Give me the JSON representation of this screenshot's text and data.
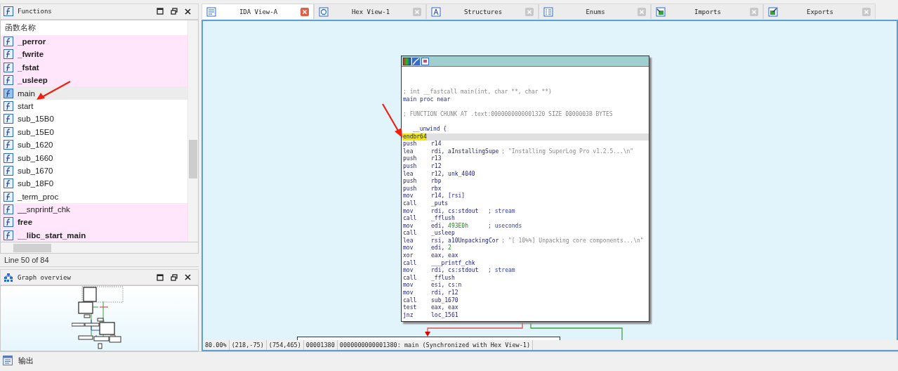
{
  "functions_panel": {
    "title": "Functions",
    "column": "函数名称",
    "items": [
      {
        "name": "_perror",
        "library": true,
        "bold": true,
        "selected": false
      },
      {
        "name": "_fwrite",
        "library": true,
        "bold": true,
        "selected": false
      },
      {
        "name": "_fstat",
        "library": true,
        "bold": true,
        "selected": false
      },
      {
        "name": "_usleep",
        "library": true,
        "bold": true,
        "selected": false
      },
      {
        "name": "main",
        "library": false,
        "bold": false,
        "selected": true
      },
      {
        "name": "start",
        "library": false,
        "bold": false,
        "selected": false
      },
      {
        "name": "sub_15B0",
        "library": false,
        "bold": false,
        "selected": false
      },
      {
        "name": "sub_15E0",
        "library": false,
        "bold": false,
        "selected": false
      },
      {
        "name": "sub_1620",
        "library": false,
        "bold": false,
        "selected": false
      },
      {
        "name": "sub_1660",
        "library": false,
        "bold": false,
        "selected": false
      },
      {
        "name": "sub_1670",
        "library": false,
        "bold": false,
        "selected": false
      },
      {
        "name": "sub_18F0",
        "library": false,
        "bold": false,
        "selected": false
      },
      {
        "name": "_term_proc",
        "library": false,
        "bold": false,
        "selected": false
      },
      {
        "name": "__snprintf_chk",
        "library": true,
        "bold": false,
        "selected": false
      },
      {
        "name": "free",
        "library": true,
        "bold": true,
        "selected": false
      },
      {
        "name": "__libc_start_main",
        "library": true,
        "bold": true,
        "selected": false
      }
    ],
    "status": "Line 50 of 84"
  },
  "overview_panel": {
    "title": "Graph overview"
  },
  "output_bar": {
    "title": "输出"
  },
  "tabs": [
    {
      "label": "IDA View-A",
      "kind": "view",
      "selected": true
    },
    {
      "label": "Hex View-1",
      "kind": "hex",
      "selected": false
    },
    {
      "label": "Structures",
      "kind": "struct",
      "selected": false
    },
    {
      "label": "Enums",
      "kind": "enum",
      "selected": false
    },
    {
      "label": "Imports",
      "kind": "import",
      "selected": false
    },
    {
      "label": "Exports",
      "kind": "export",
      "selected": false
    }
  ],
  "code": [
    {
      "kind": "comment",
      "text": "; int __fastcall main(int, char **, char **)"
    },
    {
      "kind": "label",
      "text": "main proc near"
    },
    {
      "kind": "blank"
    },
    {
      "kind": "comment",
      "text": "; FUNCTION CHUNK AT .text:0000000000001320 SIZE 0000003B BYTES"
    },
    {
      "kind": "blank"
    },
    {
      "kind": "block_start",
      "text": "__unwind {"
    },
    {
      "kind": "instr",
      "mnemonic": "endbr64",
      "current": true
    },
    {
      "kind": "instr",
      "mnemonic": "push",
      "operands": [
        {
          "text": "r14",
          "kind": "name"
        }
      ]
    },
    {
      "kind": "instr",
      "mnemonic": "lea",
      "operands": [
        {
          "text": "rdi, aInstallingSupe",
          "kind": "name"
        }
      ],
      "comment": {
        "text": "; \"Installing SuperLog Pro v1.2.5...\\n\"",
        "kind": "string"
      }
    },
    {
      "kind": "instr",
      "mnemonic": "push",
      "operands": [
        {
          "text": "r13",
          "kind": "name"
        }
      ]
    },
    {
      "kind": "instr",
      "mnemonic": "push",
      "operands": [
        {
          "text": "r12",
          "kind": "name"
        }
      ]
    },
    {
      "kind": "instr",
      "mnemonic": "lea",
      "operands": [
        {
          "text": "r12, unk_4040",
          "kind": "name"
        }
      ]
    },
    {
      "kind": "instr",
      "mnemonic": "push",
      "operands": [
        {
          "text": "rbp",
          "kind": "name"
        }
      ]
    },
    {
      "kind": "instr",
      "mnemonic": "push",
      "operands": [
        {
          "text": "rbx",
          "kind": "name"
        }
      ]
    },
    {
      "kind": "instr",
      "mnemonic": "mov",
      "operands": [
        {
          "text": "r14, [rsi]",
          "kind": "name"
        }
      ]
    },
    {
      "kind": "instr",
      "mnemonic": "call",
      "operands": [
        {
          "text": "_puts",
          "kind": "name"
        }
      ]
    },
    {
      "kind": "instr",
      "mnemonic": "mov",
      "operands": [
        {
          "text": "rdi, cs:stdout",
          "kind": "name"
        }
      ],
      "comment": {
        "text": "; stream",
        "kind": "note"
      }
    },
    {
      "kind": "instr",
      "mnemonic": "call",
      "operands": [
        {
          "text": "_fflush",
          "kind": "name"
        }
      ]
    },
    {
      "kind": "instr",
      "mnemonic": "mov",
      "operands": [
        {
          "text": "edi, ",
          "kind": "name"
        },
        {
          "text": "493E0h",
          "kind": "number"
        }
      ],
      "comment": {
        "text": "; useconds",
        "kind": "note"
      }
    },
    {
      "kind": "instr",
      "mnemonic": "call",
      "operands": [
        {
          "text": "_usleep",
          "kind": "name"
        }
      ]
    },
    {
      "kind": "instr",
      "mnemonic": "lea",
      "operands": [
        {
          "text": "rsi, a10UnpackingCor",
          "kind": "name"
        }
      ],
      "comment": {
        "text": "; \"[ 10%%] Unpacking core components...\\n\"",
        "kind": "string"
      }
    },
    {
      "kind": "instr",
      "mnemonic": "mov",
      "operands": [
        {
          "text": "edi, ",
          "kind": "name"
        },
        {
          "text": "2",
          "kind": "number"
        }
      ]
    },
    {
      "kind": "instr",
      "mnemonic": "xor",
      "operands": [
        {
          "text": "eax, eax",
          "kind": "name"
        }
      ]
    },
    {
      "kind": "instr",
      "mnemonic": "call",
      "operands": [
        {
          "text": "___printf_chk",
          "kind": "name"
        }
      ]
    },
    {
      "kind": "instr",
      "mnemonic": "mov",
      "operands": [
        {
          "text": "rdi, cs:stdout",
          "kind": "name"
        }
      ],
      "comment": {
        "text": "; stream",
        "kind": "note"
      }
    },
    {
      "kind": "instr",
      "mnemonic": "call",
      "operands": [
        {
          "text": "_fflush",
          "kind": "name"
        }
      ]
    },
    {
      "kind": "instr",
      "mnemonic": "mov",
      "operands": [
        {
          "text": "esi, cs:n",
          "kind": "name"
        }
      ]
    },
    {
      "kind": "instr",
      "mnemonic": "mov",
      "operands": [
        {
          "text": "rdi, r12",
          "kind": "name"
        }
      ]
    },
    {
      "kind": "instr",
      "mnemonic": "call",
      "operands": [
        {
          "text": "sub_1670",
          "kind": "name"
        }
      ]
    },
    {
      "kind": "instr",
      "mnemonic": "test",
      "operands": [
        {
          "text": "eax, eax",
          "kind": "name"
        }
      ]
    },
    {
      "kind": "instr",
      "mnemonic": "jnz",
      "operands": [
        {
          "text": "loc_1561",
          "kind": "name"
        }
      ]
    }
  ],
  "status_bar": [
    "80.00%",
    "(218,-75)",
    "(754,465)",
    "00001380",
    "0000000000001380: main (Synchronized with Hex View-1)"
  ]
}
